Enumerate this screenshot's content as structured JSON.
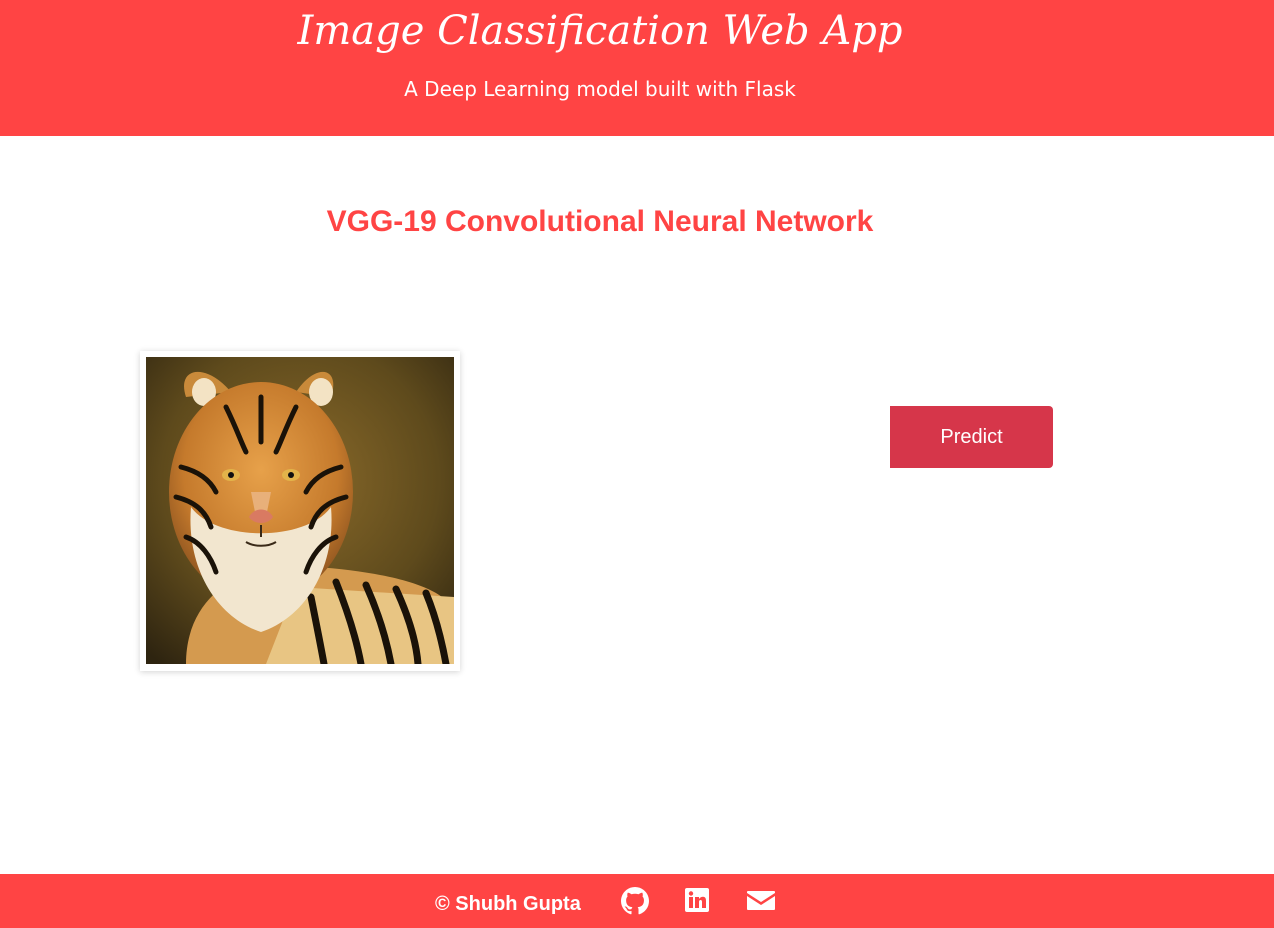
{
  "header": {
    "title": "Image Classification Web App",
    "subtitle": "A Deep Learning model built with Flask"
  },
  "main": {
    "section_title": "VGG-19 Convolutional Neural Network",
    "predict_label": "Predict"
  },
  "footer": {
    "copyright": "© Shubh Gupta",
    "icons": [
      "github-icon",
      "linkedin-icon",
      "envelope-icon"
    ]
  },
  "colors": {
    "accent": "#ff4444",
    "button": "#d6364a",
    "background": "#ffffff"
  }
}
